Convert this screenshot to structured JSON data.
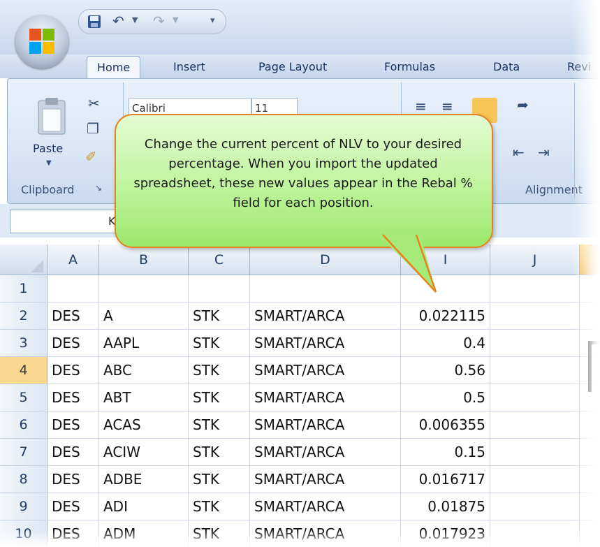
{
  "quick_access": {
    "save_icon": "save-icon",
    "undo_icon": "undo-icon",
    "redo_icon": "redo-icon",
    "customize_icon": "customize-qat-icon"
  },
  "tabs": [
    "Home",
    "Insert",
    "Page Layout",
    "Formulas",
    "Data",
    "Revi"
  ],
  "ribbon": {
    "paste_label": "Paste",
    "clipboard_label": "Clipboard",
    "alignment_label": "Alignment",
    "font_name": "Calibri",
    "font_size": "11"
  },
  "name_box": "K4",
  "callout": {
    "text": "Change the current percent of NLV to your desired percentage. When you import the updated spreadsheet, these new values appear in the Rebal % field for each position."
  },
  "grid": {
    "columns": [
      "A",
      "B",
      "C",
      "D",
      "I",
      "J"
    ],
    "selected_row": "4",
    "rows": [
      {
        "num": "1",
        "a": "",
        "b": "",
        "c": "",
        "d": "",
        "i": ""
      },
      {
        "num": "2",
        "a": "DES",
        "b": "A",
        "c": "STK",
        "d": "SMART/ARCA",
        "i": "0.022115"
      },
      {
        "num": "3",
        "a": "DES",
        "b": "AAPL",
        "c": "STK",
        "d": "SMART/ARCA",
        "i": "0.4"
      },
      {
        "num": "4",
        "a": "DES",
        "b": "ABC",
        "c": "STK",
        "d": "SMART/ARCA",
        "i": "0.56"
      },
      {
        "num": "5",
        "a": "DES",
        "b": "ABT",
        "c": "STK",
        "d": "SMART/ARCA",
        "i": "0.5"
      },
      {
        "num": "6",
        "a": "DES",
        "b": "ACAS",
        "c": "STK",
        "d": "SMART/ARCA",
        "i": "0.006355"
      },
      {
        "num": "7",
        "a": "DES",
        "b": "ACIW",
        "c": "STK",
        "d": "SMART/ARCA",
        "i": "0.15"
      },
      {
        "num": "8",
        "a": "DES",
        "b": "ADBE",
        "c": "STK",
        "d": "SMART/ARCA",
        "i": "0.016717"
      },
      {
        "num": "9",
        "a": "DES",
        "b": "ADI",
        "c": "STK",
        "d": "SMART/ARCA",
        "i": "0.01875"
      },
      {
        "num": "10",
        "a": "DES",
        "b": "ADM",
        "c": "STK",
        "d": "SMART/ARCA",
        "i": "0.017923"
      }
    ]
  }
}
